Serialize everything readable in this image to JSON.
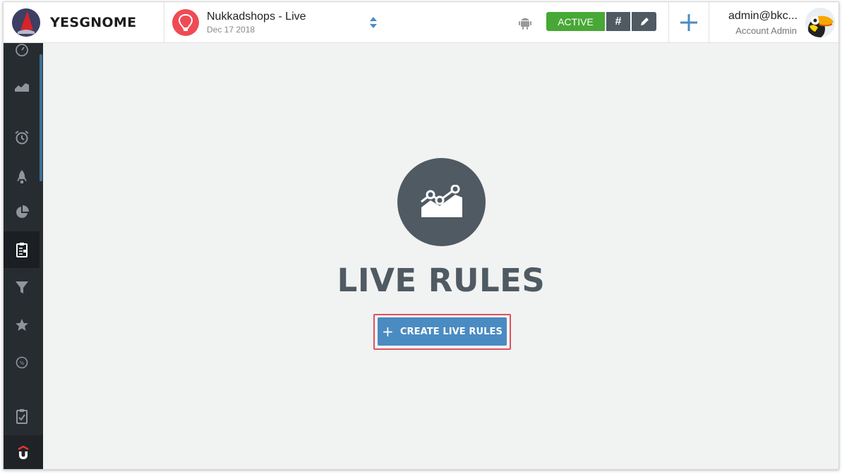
{
  "brand": {
    "name": "YESGNOME",
    "logo_icon": "yesgnome-logo-icon"
  },
  "app": {
    "name": "Nukkadshops - Live",
    "date": "Dec 17 2018",
    "icon": "hot-air-balloon-icon",
    "icon_color": "#ef4b55"
  },
  "platform": {
    "icon": "android-icon"
  },
  "status": {
    "label": "ACTIVE",
    "hash_label": "#",
    "edit_icon": "pencil-icon",
    "active_color": "#47a836"
  },
  "header": {
    "add_icon": "plus-icon"
  },
  "user": {
    "email": "admin@bkc...",
    "role": "Account Admin",
    "avatar": "toucan-avatar"
  },
  "sidebar": {
    "items": [
      {
        "name": "dashboard-icon"
      },
      {
        "name": "analytics-icon"
      },
      {
        "name": "alarm-clock-icon"
      },
      {
        "name": "rocket-icon"
      },
      {
        "name": "pie-chart-icon"
      },
      {
        "name": "clipboard-icon",
        "active": true
      },
      {
        "name": "funnel-icon"
      },
      {
        "name": "star-icon"
      },
      {
        "name": "percent-icon"
      },
      {
        "name": "checklist-icon"
      }
    ],
    "bottom_icon": "magnet-logo-icon"
  },
  "main": {
    "empty_icon": "trend-chart-icon",
    "title": "LIVE RULES",
    "create_button": {
      "plus": "+",
      "label": "CREATE LIVE RULES"
    }
  },
  "colors": {
    "primary": "#4a8bc2",
    "dark": "#4f5a63",
    "sidebar": "#272c31",
    "highlight": "#e0525f"
  }
}
